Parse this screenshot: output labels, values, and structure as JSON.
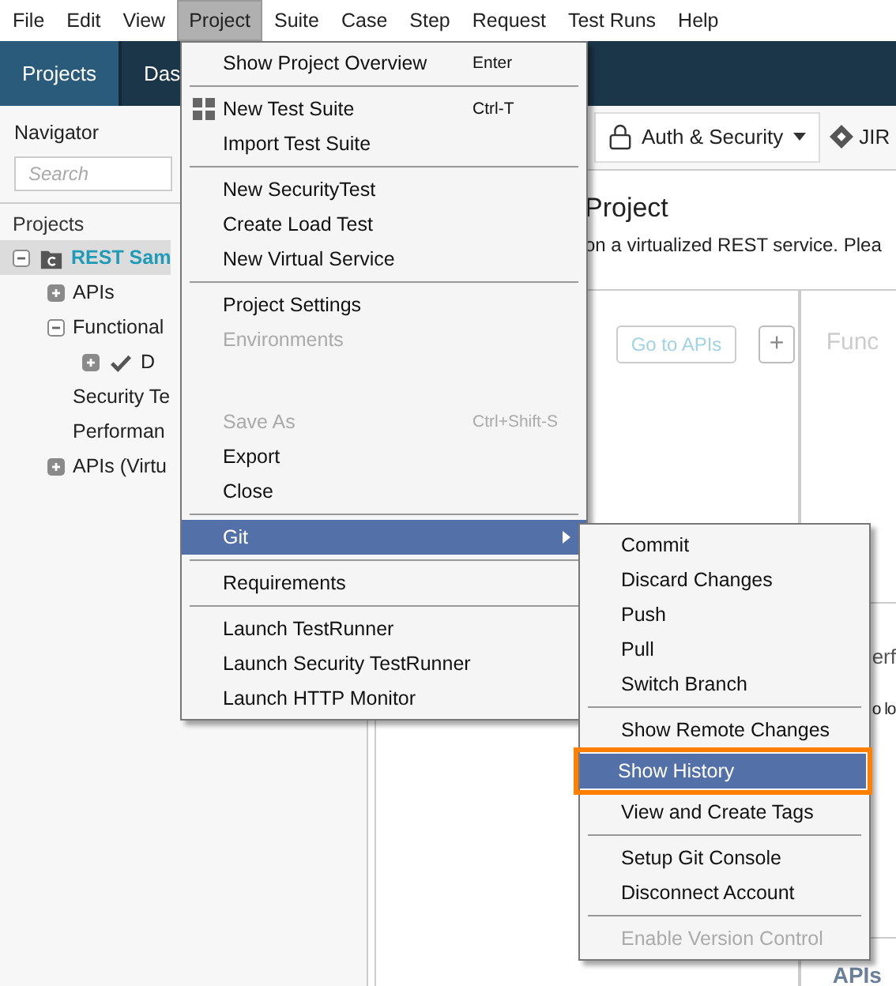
{
  "menubar": [
    {
      "label": "File",
      "selected": false
    },
    {
      "label": "Edit",
      "selected": false
    },
    {
      "label": "View",
      "selected": false
    },
    {
      "label": "Project",
      "selected": true
    },
    {
      "label": "Suite",
      "selected": false
    },
    {
      "label": "Case",
      "selected": false
    },
    {
      "label": "Step",
      "selected": false
    },
    {
      "label": "Request",
      "selected": false
    },
    {
      "label": "Test Runs",
      "selected": false
    },
    {
      "label": "Help",
      "selected": false
    }
  ],
  "tabs": [
    {
      "label": "Projects",
      "selected": true
    },
    {
      "label": "Das",
      "selected": false
    }
  ],
  "navigator": {
    "title": "Navigator",
    "search": {
      "placeholder": "Search"
    },
    "tree_title": "Projects",
    "tree": [
      {
        "kind": "project",
        "label": "REST Sam",
        "selected": true,
        "expanded": true,
        "children": [
          {
            "kind": "folder",
            "label": "APIs",
            "selected": false,
            "expanded": false
          },
          {
            "kind": "folder",
            "label": "Functional",
            "selected": false,
            "expanded": true,
            "children": [
              {
                "kind": "test",
                "label": "D",
                "selected": false,
                "expanded": false
              }
            ]
          },
          {
            "kind": "folder",
            "label": "Security Te",
            "selected": false
          },
          {
            "kind": "folder",
            "label": "Performan",
            "selected": false
          },
          {
            "kind": "folder",
            "label": "APIs (Virtu",
            "selected": false,
            "expanded": false
          }
        ]
      }
    ]
  },
  "toolbar": {
    "auth_button": "Auth & Security",
    "jira": "JIR"
  },
  "overview": {
    "title": "Project",
    "description": "on a virtualized REST service. Plea",
    "go_to_apis": "Go to APIs",
    "add": "+"
  },
  "side_cards": [
    {
      "title": "Func",
      "faded": true
    },
    {
      "title": "erf",
      "text": "o lo",
      "faded": false
    },
    {
      "title": "APIs",
      "faded": false
    }
  ],
  "menu": [
    {
      "kind": "item",
      "label": "Show Project Overview",
      "shortcut": "Enter",
      "selected": false,
      "disabled": false
    },
    {
      "kind": "separator"
    },
    {
      "kind": "suite-item",
      "label": "New Test Suite",
      "shortcut": "Ctrl-T",
      "selected": false,
      "disabled": false
    },
    {
      "kind": "item",
      "label": "Import Test Suite",
      "selected": false,
      "disabled": false
    },
    {
      "kind": "separator"
    },
    {
      "kind": "item",
      "label": "New SecurityTest",
      "selected": false,
      "disabled": false
    },
    {
      "kind": "item",
      "label": "Create Load Test",
      "selected": false,
      "disabled": false
    },
    {
      "kind": "item",
      "label": "New Virtual Service",
      "selected": false,
      "disabled": false
    },
    {
      "kind": "separator"
    },
    {
      "kind": "item",
      "label": "Project Settings",
      "selected": false,
      "disabled": false
    },
    {
      "kind": "item",
      "label": "Environments",
      "selected": false,
      "disabled": true
    },
    {
      "kind": "blank"
    },
    {
      "kind": "item",
      "label": "Save As",
      "shortcut": "Ctrl+Shift-S",
      "selected": false,
      "disabled": true
    },
    {
      "kind": "item",
      "label": "Export",
      "selected": false,
      "disabled": false
    },
    {
      "kind": "item",
      "label": "Close",
      "selected": false,
      "disabled": false
    },
    {
      "kind": "separator"
    },
    {
      "kind": "item",
      "label": "Git",
      "submenu": true,
      "selected": true,
      "disabled": false
    },
    {
      "kind": "separator"
    },
    {
      "kind": "item",
      "label": "Requirements",
      "selected": false,
      "disabled": false
    },
    {
      "kind": "separator"
    },
    {
      "kind": "item",
      "label": "Launch TestRunner",
      "selected": false,
      "disabled": false
    },
    {
      "kind": "item",
      "label": "Launch Security TestRunner",
      "selected": false,
      "disabled": false
    },
    {
      "kind": "item",
      "label": "Launch HTTP Monitor",
      "selected": false,
      "disabled": false
    }
  ],
  "git_menu": [
    {
      "kind": "item",
      "label": "Commit",
      "selected": false,
      "disabled": false
    },
    {
      "kind": "item",
      "label": "Discard Changes",
      "selected": false,
      "disabled": false
    },
    {
      "kind": "item",
      "label": "Push",
      "selected": false,
      "disabled": false
    },
    {
      "kind": "item",
      "label": "Pull",
      "selected": false,
      "disabled": false
    },
    {
      "kind": "item",
      "label": "Switch Branch",
      "selected": false,
      "disabled": false
    },
    {
      "kind": "separator"
    },
    {
      "kind": "item",
      "label": "Show Remote Changes",
      "selected": false,
      "disabled": false
    },
    {
      "kind": "item",
      "label": "Show History",
      "selected": true,
      "disabled": false,
      "callout": true
    },
    {
      "kind": "item",
      "label": "View and Create Tags",
      "selected": false,
      "disabled": false
    },
    {
      "kind": "separator"
    },
    {
      "kind": "item",
      "label": "Setup Git Console",
      "selected": false,
      "disabled": false
    },
    {
      "kind": "item",
      "label": "Disconnect Account",
      "selected": false,
      "disabled": false
    },
    {
      "kind": "separator"
    },
    {
      "kind": "item",
      "label": "Enable Version Control",
      "selected": false,
      "disabled": true
    }
  ]
}
